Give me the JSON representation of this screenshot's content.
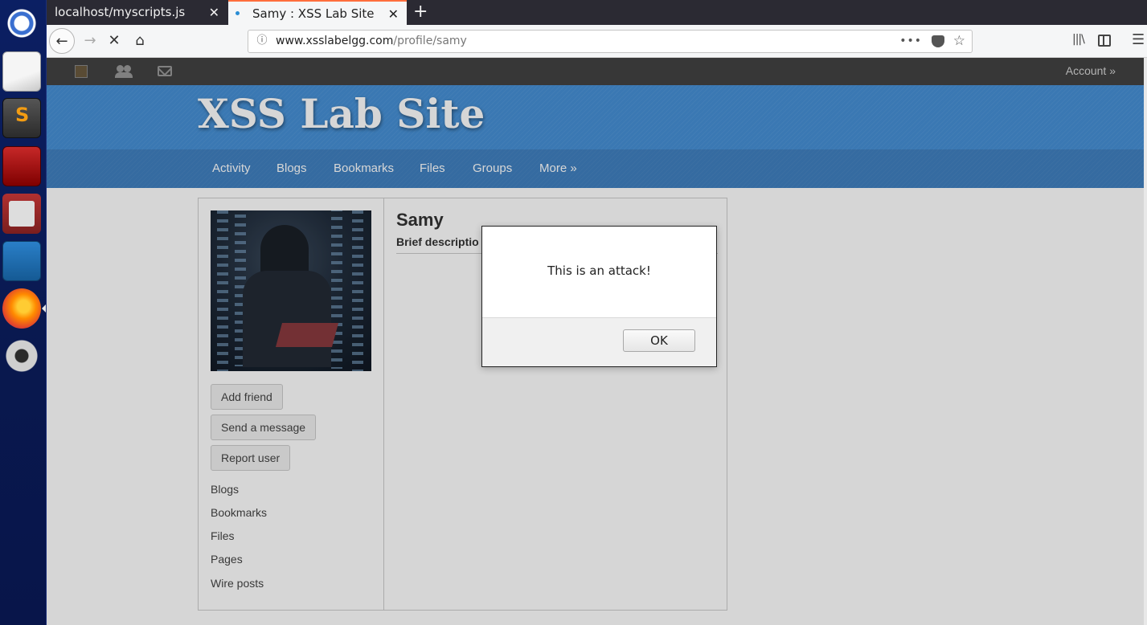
{
  "browser": {
    "tabs": [
      {
        "title": "localhost/myscripts.js",
        "close": "✕"
      },
      {
        "title": "Samy : XSS Lab Site",
        "close": "✕",
        "active": true
      }
    ],
    "new_tab": "+",
    "url_host": "www.xsslabelgg.com",
    "url_path": "/profile/samy",
    "url_more": "•••",
    "star": "☆",
    "library": "|||\\",
    "menu": "☰",
    "back": "←",
    "forward": "→",
    "stop": "✕",
    "home": "⌂",
    "info": "ⓘ"
  },
  "topbar": {
    "account": "Account »"
  },
  "site": {
    "title": "XSS Lab Site",
    "nav": [
      "Activity",
      "Blogs",
      "Bookmarks",
      "Files",
      "Groups",
      "More »"
    ]
  },
  "profile": {
    "name": "Samy",
    "brief": "Brief descriptio",
    "actions": [
      "Add friend",
      "Send a message",
      "Report user"
    ],
    "links": [
      "Blogs",
      "Bookmarks",
      "Files",
      "Pages",
      "Wire posts"
    ]
  },
  "alert": {
    "message": "This is an attack!",
    "ok": "OK"
  },
  "colors": {
    "header_blue": "#4690d6",
    "nav_blue": "#4080c0",
    "topbar": "#424242",
    "tab_accent": "#ff6e3d"
  }
}
